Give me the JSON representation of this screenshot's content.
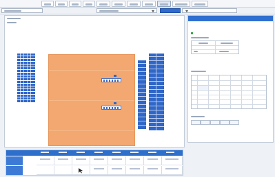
{
  "colors": {
    "accent": "#2f6fd0",
    "court": "#f2a870",
    "seat": "#2f66c7",
    "panel_border": "#c2ccd9"
  },
  "toolbar": {
    "tabs": [
      {
        "icon": "menu-tab-placeholder"
      },
      {
        "icon": "menu-tab-placeholder"
      },
      {
        "icon": "menu-tab-placeholder"
      },
      {
        "icon": "menu-tab-placeholder"
      },
      {
        "icon": "menu-tab-placeholder"
      },
      {
        "icon": "menu-tab-placeholder"
      },
      {
        "icon": "menu-tab-placeholder"
      },
      {
        "icon": "menu-tab-placeholder"
      },
      {
        "icon": "menu-tab-placeholder",
        "active": true
      },
      {
        "icon": "menu-tab-placeholder"
      },
      {
        "icon": "menu-tab-placeholder"
      }
    ]
  },
  "icons": {
    "dropdown": "chevron-down-icon",
    "left_seats": "seat-block-icon",
    "right_seats": "seat-block-icon",
    "court": "court-icon"
  }
}
